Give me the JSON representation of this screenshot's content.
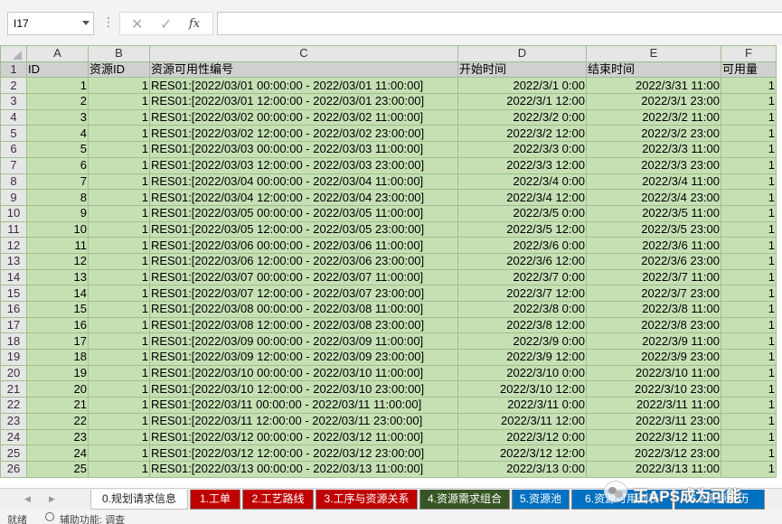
{
  "formula_bar": {
    "name_box": "I17",
    "formula": "",
    "cancel_glyph": "✕",
    "enter_glyph": "✓",
    "fx_label": "fx"
  },
  "columns": [
    "A",
    "B",
    "C",
    "D",
    "E",
    "F"
  ],
  "header_row": [
    "ID",
    "资源ID",
    "资源可用性编号",
    "开始时间",
    "结束时间",
    "可用量"
  ],
  "rows": [
    {
      "r": "2",
      "id": "1",
      "res": "1",
      "code": "RES01:[2022/03/01 00:00:00 - 2022/03/01 11:00:00]",
      "start": "2022/3/1 0:00",
      "end": "2022/3/31 11:00",
      "qty": "1"
    },
    {
      "r": "3",
      "id": "2",
      "res": "1",
      "code": "RES01:[2022/03/01 12:00:00 - 2022/03/01 23:00:00]",
      "start": "2022/3/1 12:00",
      "end": "2022/3/1 23:00",
      "qty": "1"
    },
    {
      "r": "4",
      "id": "3",
      "res": "1",
      "code": "RES01:[2022/03/02 00:00:00 - 2022/03/02 11:00:00]",
      "start": "2022/3/2 0:00",
      "end": "2022/3/2 11:00",
      "qty": "1"
    },
    {
      "r": "5",
      "id": "4",
      "res": "1",
      "code": "RES01:[2022/03/02 12:00:00 - 2022/03/02 23:00:00]",
      "start": "2022/3/2 12:00",
      "end": "2022/3/2 23:00",
      "qty": "1"
    },
    {
      "r": "6",
      "id": "5",
      "res": "1",
      "code": "RES01:[2022/03/03 00:00:00 - 2022/03/03 11:00:00]",
      "start": "2022/3/3 0:00",
      "end": "2022/3/3 11:00",
      "qty": "1"
    },
    {
      "r": "7",
      "id": "6",
      "res": "1",
      "code": "RES01:[2022/03/03 12:00:00 - 2022/03/03 23:00:00]",
      "start": "2022/3/3 12:00",
      "end": "2022/3/3 23:00",
      "qty": "1"
    },
    {
      "r": "8",
      "id": "7",
      "res": "1",
      "code": "RES01:[2022/03/04 00:00:00 - 2022/03/04 11:00:00]",
      "start": "2022/3/4 0:00",
      "end": "2022/3/4 11:00",
      "qty": "1"
    },
    {
      "r": "9",
      "id": "8",
      "res": "1",
      "code": "RES01:[2022/03/04 12:00:00 - 2022/03/04 23:00:00]",
      "start": "2022/3/4 12:00",
      "end": "2022/3/4 23:00",
      "qty": "1"
    },
    {
      "r": "10",
      "id": "9",
      "res": "1",
      "code": "RES01:[2022/03/05 00:00:00 - 2022/03/05 11:00:00]",
      "start": "2022/3/5 0:00",
      "end": "2022/3/5 11:00",
      "qty": "1"
    },
    {
      "r": "11",
      "id": "10",
      "res": "1",
      "code": "RES01:[2022/03/05 12:00:00 - 2022/03/05 23:00:00]",
      "start": "2022/3/5 12:00",
      "end": "2022/3/5 23:00",
      "qty": "1"
    },
    {
      "r": "12",
      "id": "11",
      "res": "1",
      "code": "RES01:[2022/03/06 00:00:00 - 2022/03/06 11:00:00]",
      "start": "2022/3/6 0:00",
      "end": "2022/3/6 11:00",
      "qty": "1"
    },
    {
      "r": "13",
      "id": "12",
      "res": "1",
      "code": "RES01:[2022/03/06 12:00:00 - 2022/03/06 23:00:00]",
      "start": "2022/3/6 12:00",
      "end": "2022/3/6 23:00",
      "qty": "1"
    },
    {
      "r": "14",
      "id": "13",
      "res": "1",
      "code": "RES01:[2022/03/07 00:00:00 - 2022/03/07 11:00:00]",
      "start": "2022/3/7 0:00",
      "end": "2022/3/7 11:00",
      "qty": "1"
    },
    {
      "r": "15",
      "id": "14",
      "res": "1",
      "code": "RES01:[2022/03/07 12:00:00 - 2022/03/07 23:00:00]",
      "start": "2022/3/7 12:00",
      "end": "2022/3/7 23:00",
      "qty": "1"
    },
    {
      "r": "16",
      "id": "15",
      "res": "1",
      "code": "RES01:[2022/03/08 00:00:00 - 2022/03/08 11:00:00]",
      "start": "2022/3/8 0:00",
      "end": "2022/3/8 11:00",
      "qty": "1"
    },
    {
      "r": "17",
      "id": "16",
      "res": "1",
      "code": "RES01:[2022/03/08 12:00:00 - 2022/03/08 23:00:00]",
      "start": "2022/3/8 12:00",
      "end": "2022/3/8 23:00",
      "qty": "1"
    },
    {
      "r": "18",
      "id": "17",
      "res": "1",
      "code": "RES01:[2022/03/09 00:00:00 - 2022/03/09 11:00:00]",
      "start": "2022/3/9 0:00",
      "end": "2022/3/9 11:00",
      "qty": "1"
    },
    {
      "r": "19",
      "id": "18",
      "res": "1",
      "code": "RES01:[2022/03/09 12:00:00 - 2022/03/09 23:00:00]",
      "start": "2022/3/9 12:00",
      "end": "2022/3/9 23:00",
      "qty": "1"
    },
    {
      "r": "20",
      "id": "19",
      "res": "1",
      "code": "RES01:[2022/03/10 00:00:00 - 2022/03/10 11:00:00]",
      "start": "2022/3/10 0:00",
      "end": "2022/3/10 11:00",
      "qty": "1"
    },
    {
      "r": "21",
      "id": "20",
      "res": "1",
      "code": "RES01:[2022/03/10 12:00:00 - 2022/03/10 23:00:00]",
      "start": "2022/3/10 12:00",
      "end": "2022/3/10 23:00",
      "qty": "1"
    },
    {
      "r": "22",
      "id": "21",
      "res": "1",
      "code": "RES01:[2022/03/11 00:00:00 - 2022/03/11 11:00:00]",
      "start": "2022/3/11 0:00",
      "end": "2022/3/11 11:00",
      "qty": "1"
    },
    {
      "r": "23",
      "id": "22",
      "res": "1",
      "code": "RES01:[2022/03/11 12:00:00 - 2022/03/11 23:00:00]",
      "start": "2022/3/11 12:00",
      "end": "2022/3/11 23:00",
      "qty": "1"
    },
    {
      "r": "24",
      "id": "23",
      "res": "1",
      "code": "RES01:[2022/03/12 00:00:00 - 2022/03/12 11:00:00]",
      "start": "2022/3/12 0:00",
      "end": "2022/3/12 11:00",
      "qty": "1"
    },
    {
      "r": "25",
      "id": "24",
      "res": "1",
      "code": "RES01:[2022/03/12 12:00:00 - 2022/03/12 23:00:00]",
      "start": "2022/3/12 12:00",
      "end": "2022/3/12 23:00",
      "qty": "1"
    },
    {
      "r": "26",
      "id": "25",
      "res": "1",
      "code": "RES01:[2022/03/13 00:00:00 - 2022/03/13 11:00:00]",
      "start": "2022/3/13 0:00",
      "end": "2022/3/13 11:00",
      "qty": "1"
    }
  ],
  "tabs": [
    {
      "label": "0.规划请求信息",
      "color": "#ffffff",
      "active": true
    },
    {
      "label": "1.工单",
      "color": "#c00000",
      "active": false
    },
    {
      "label": "2.工艺路线",
      "color": "#c00000",
      "active": false
    },
    {
      "label": "3.工序与资源关系",
      "color": "#c00000",
      "active": false
    },
    {
      "label": "4.资源需求组合",
      "color": "#375623",
      "active": false
    },
    {
      "label": "5.资源池",
      "color": "#0070c0",
      "active": false
    },
    {
      "label": "6.资源可用列表",
      "color": "#0070c0",
      "active": false
    },
    {
      "label": "6.2资源日历",
      "color": "#0070c0",
      "active": false
    }
  ],
  "status": {
    "ready": "就绪",
    "accessibility": "辅助功能: 调查"
  },
  "watermark": {
    "text": "正APS成为可能"
  },
  "colors": {
    "data_fill": "#c6e0b4",
    "header_fill": "#d0d0d0",
    "grid_line": "#9fbf8f",
    "tab_red": "#c00000",
    "tab_green": "#375623",
    "tab_blue": "#0070c0"
  }
}
